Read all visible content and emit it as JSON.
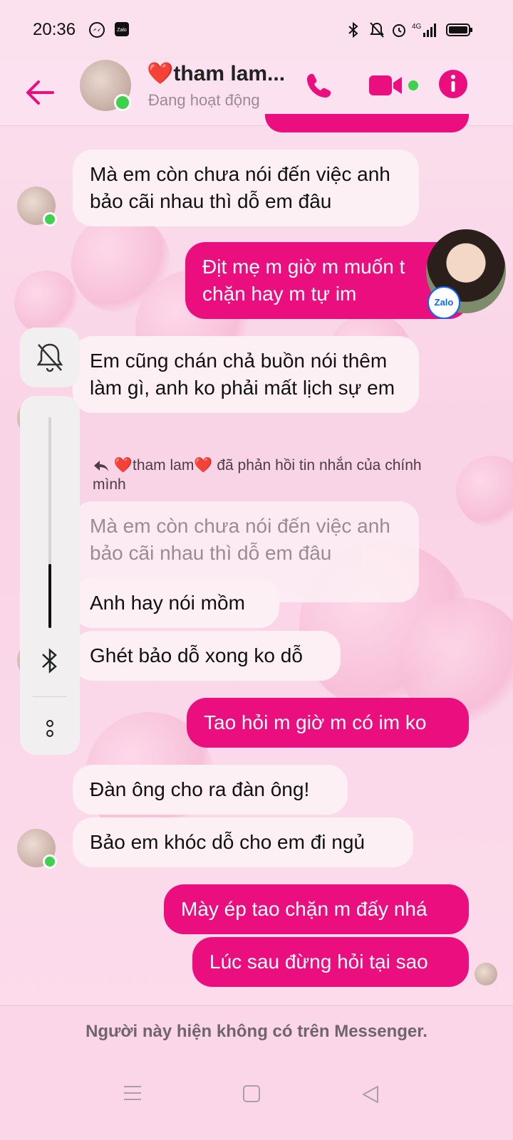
{
  "status_bar": {
    "time": "20:36",
    "left_icons": [
      "messenger-icon",
      "zalo-icon"
    ],
    "right_icons": [
      "bluetooth-icon",
      "mute-icon",
      "alarm-icon",
      "signal-4g-icon",
      "battery-icon"
    ],
    "network_label": "4G"
  },
  "header": {
    "contact_name": "❤️tham lam...",
    "status": "Đang hoạt động",
    "accent": "#ea0e7e"
  },
  "messages": [
    {
      "side": "in",
      "text": "Mà em còn chưa nói đến việc anh bảo cãi nhau thì dỗ em đâu"
    },
    {
      "side": "out",
      "text": "Địt mẹ m giờ m muốn t chặn hay m tự im"
    },
    {
      "side": "in",
      "text": "Em cũng chán chả buồn nói thêm làm gì, anh ko phải mất lịch sự em"
    },
    {
      "side": "in",
      "text": "Mà em còn chưa nói đến việc anh bảo cãi nhau thì dỗ em đâu",
      "quoted": true
    },
    {
      "side": "in",
      "text": "Anh hay nói mồm"
    },
    {
      "side": "in",
      "text": "Ghét bảo dỗ xong ko dỗ"
    },
    {
      "side": "out",
      "text": "Tao hỏi m giờ m có im ko"
    },
    {
      "side": "in",
      "text": "Đàn ông cho ra đàn ông!"
    },
    {
      "side": "in",
      "text": "Bảo em khóc dỗ cho em đi ngủ"
    },
    {
      "side": "out",
      "text": "Mày ép tao chặn m đấy nhá"
    },
    {
      "side": "out",
      "text": "Lúc sau đừng hỏi tại sao"
    }
  ],
  "reply_note": "❤️tham lam❤️ đã phản hồi tin nhắn của chính mình",
  "overlay": {
    "zalo_badge": "Zalo"
  },
  "footer": {
    "note": "Người này hiện không có trên Messenger."
  }
}
